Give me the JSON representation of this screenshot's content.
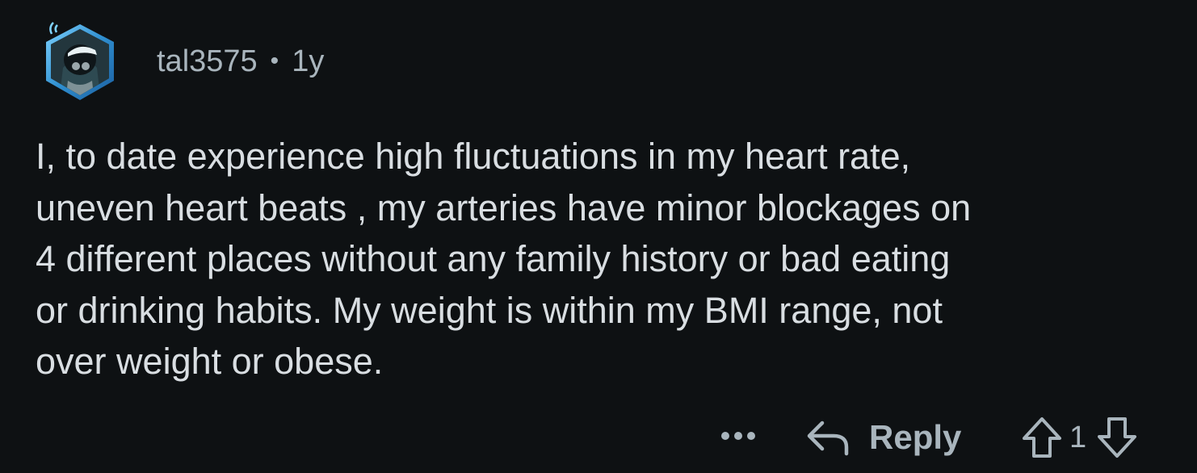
{
  "comment": {
    "author": "tal3575",
    "separator": "•",
    "age": "1y",
    "body_lines": [
      "I, to date experience high fluctuations in my heart rate,",
      "uneven heart beats , my arteries have minor blockages on",
      "4 different places without any family history or bad eating",
      "or drinking habits. My weight is within my BMI range, not",
      "over weight or obese."
    ]
  },
  "actions": {
    "more_icon": "ellipsis-icon",
    "reply_icon": "reply-arrow-icon",
    "reply_label": "Reply",
    "upvote_icon": "arrow-up-icon",
    "score": "1",
    "downvote_icon": "arrow-down-icon"
  },
  "colors": {
    "background": "#0e1113",
    "text": "#d9dee2",
    "muted": "#a9b5bd",
    "avatar_border": "#3fa0d8"
  }
}
